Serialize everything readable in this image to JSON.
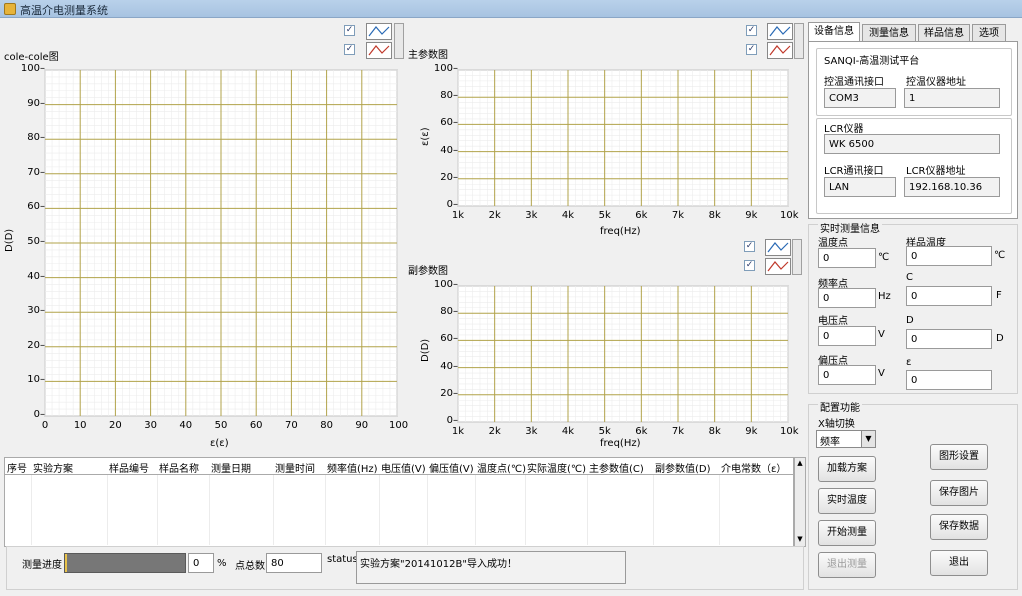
{
  "window": {
    "title": "高温介电测量系统"
  },
  "colors": {
    "grid": "#b2a34a",
    "accent": "#2a6ab5",
    "graph_bg": "#ffffff"
  },
  "graphs": [
    {
      "id": "cole",
      "title": "cole-cole图",
      "xlabel": "ε(ε)",
      "ylabel": "D(D)",
      "xticks": [
        "0",
        "10",
        "20",
        "30",
        "40",
        "50",
        "60",
        "70",
        "80",
        "90",
        "100"
      ],
      "yticks": [
        "0",
        "10",
        "20",
        "30",
        "40",
        "50",
        "60",
        "70",
        "80",
        "90",
        "100"
      ],
      "series": [
        {
          "checked": "✓"
        },
        {
          "checked": "✓"
        }
      ]
    },
    {
      "id": "main",
      "title": "主参数图",
      "xlabel": "freq(Hz)",
      "ylabel": "ε(ε)",
      "xticks": [
        "1k",
        "2k",
        "3k",
        "4k",
        "5k",
        "6k",
        "7k",
        "8k",
        "9k",
        "10k"
      ],
      "yticks": [
        "0",
        "20",
        "40",
        "60",
        "80",
        "100"
      ],
      "series": [
        {
          "checked": "✓"
        },
        {
          "checked": "✓"
        }
      ]
    },
    {
      "id": "sub",
      "title": "副参数图",
      "xlabel": "freq(Hz)",
      "ylabel": "D(D)",
      "xticks": [
        "1k",
        "2k",
        "3k",
        "4k",
        "5k",
        "6k",
        "7k",
        "8k",
        "9k",
        "10k"
      ],
      "yticks": [
        "0",
        "20",
        "40",
        "60",
        "80",
        "100"
      ],
      "series": [
        {
          "checked": "✓"
        },
        {
          "checked": "✓"
        }
      ]
    }
  ],
  "tabs": [
    "设备信息",
    "测量信息",
    "样品信息",
    "选项"
  ],
  "device": {
    "platform": "SANQI-高温测试平台",
    "temp_port_label": "控温通讯接口",
    "temp_port": "COM3",
    "temp_addr_label": "控温仪器地址",
    "temp_addr": "1",
    "lcr_label": "LCR仪器",
    "lcr": "WK 6500",
    "lcr_port_label": "LCR通讯接口",
    "lcr_port": "LAN",
    "lcr_addr_label": "LCR仪器地址",
    "lcr_addr": "192.168.10.36"
  },
  "realtime": {
    "title": "实时测量信息",
    "temp_point_label": "温度点",
    "temp_point": "0",
    "temp_point_unit": "℃",
    "sample_temp_label": "样品温度",
    "sample_temp": "0",
    "sample_temp_unit": "℃",
    "freq_label": "频率点",
    "freq": "0",
    "freq_unit": "Hz",
    "c_label": "C",
    "c": "0",
    "c_unit": "F",
    "volt_label": "电压点",
    "volt": "0",
    "volt_unit": "V",
    "d_label": "D",
    "d": "0",
    "d_unit": "D",
    "bias_label": "偏压点",
    "bias": "0",
    "bias_unit": "V",
    "eps_label": "ε",
    "eps": "0"
  },
  "config": {
    "title": "配置功能",
    "x_switch_label": "X轴切换",
    "x_switch_value": "频率"
  },
  "buttons": {
    "load_plan": "加载方案",
    "realtime_temp": "实时温度",
    "start": "开始测量",
    "exit_measure": "退出测量",
    "graph_settings": "图形设置",
    "save_image": "保存图片",
    "save_data": "保存数据",
    "exit": "退出"
  },
  "table": {
    "headers": [
      "序号",
      "实验方案",
      "样品编号",
      "样品名称",
      "测量日期",
      "测量时间",
      "频率值(Hz)",
      "电压值(V)",
      "偏压值(V)",
      "温度点(℃)",
      "实际温度(℃)",
      "主参数值(C)",
      "副参数值(D)",
      "介电常数（ε）"
    ]
  },
  "progress": {
    "label": "测量进度",
    "value": "0",
    "unit": "%",
    "fill_fraction": 0.0
  },
  "points": {
    "label": "点总数",
    "value": "80"
  },
  "status": {
    "label": "status",
    "text": "实验方案\"20141012B\"导入成功！"
  }
}
